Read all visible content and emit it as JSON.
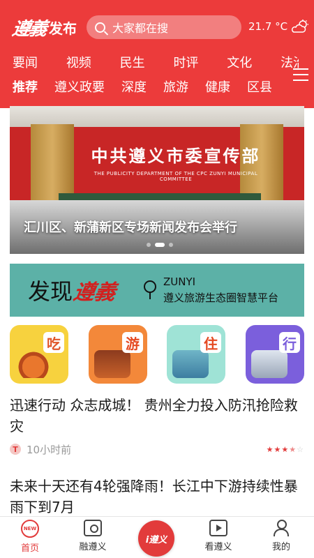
{
  "header": {
    "logo_script": "遵義",
    "logo_text": "发布",
    "search_placeholder": "大家都在搜",
    "weather": "21.7 °C",
    "weather_icon": "cloudy-sun-icon",
    "accent": "#ec3b3b"
  },
  "nav_row1": [
    "要闻",
    "视频",
    "民生",
    "时评",
    "文化",
    "法治"
  ],
  "nav_row2": [
    "推荐",
    "遵义政要",
    "深度",
    "旅游",
    "健康",
    "区县"
  ],
  "nav_active": "推荐",
  "banner": {
    "sign_cn": "中共遵义市委宣传部",
    "sign_en": "THE PUBLICITY DEPARTMENT OF THE CPC ZUNYI MUNICIPAL COMMITTEE",
    "caption": "汇川区、新蒲新区专场新闻发布会举行"
  },
  "discover": {
    "lead": "发现",
    "brand": "遵義",
    "en": "ZUNYI",
    "cn": "遵义旅游生态圈智慧平台"
  },
  "tiles": [
    {
      "glyph": "吃",
      "name": "eat"
    },
    {
      "glyph": "游",
      "name": "tour"
    },
    {
      "glyph": "住",
      "name": "stay"
    },
    {
      "glyph": "行",
      "name": "travel"
    }
  ],
  "news": [
    {
      "title": "迅速行动 众志成城！ 贵州全力投入防汛抢险救灾",
      "badge": "T",
      "time": "10小时前",
      "stars": 3.5
    },
    {
      "title": "未来十天还有4轮强降雨！长江中下游持续性暴雨下到7月"
    }
  ],
  "tabbar": {
    "home": "首页",
    "home_badge": "NEW",
    "rong": "融遵义",
    "center": "i遵义",
    "kan": "看遵义",
    "mine": "我的"
  }
}
